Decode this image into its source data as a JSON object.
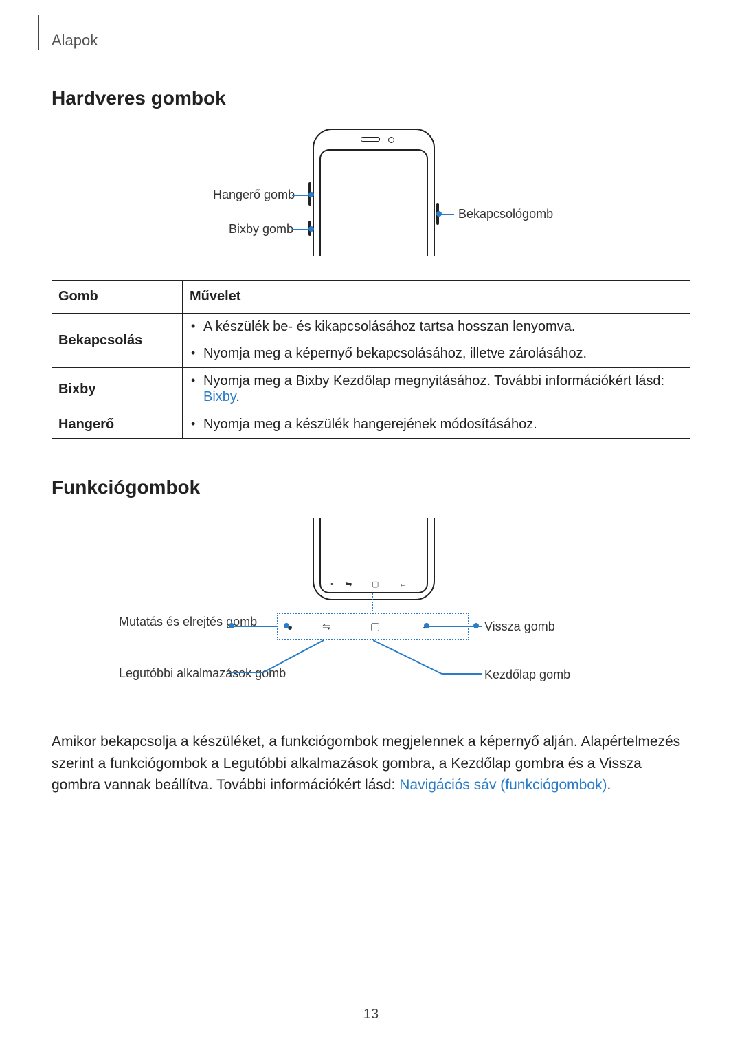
{
  "breadcrumb": "Alapok",
  "section1_title": "Hardveres gombok",
  "diagram1": {
    "volume_label": "Hangerő gomb",
    "bixby_label": "Bixby gomb",
    "power_label": "Bekapcsológomb"
  },
  "table": {
    "header_key": "Gomb",
    "header_action": "Művelet",
    "rows": [
      {
        "key": "Bekapcsolás",
        "actions": [
          "A készülék be- és kikapcsolásához tartsa hosszan lenyomva.",
          "Nyomja meg a képernyő bekapcsolásához, illetve zárolásához."
        ]
      },
      {
        "key": "Bixby",
        "actions_html": {
          "pre": "Nyomja meg a Bixby Kezdőlap megnyitásához. További információkért lásd: ",
          "link": "Bixby",
          "post": "."
        }
      },
      {
        "key": "Hangerő",
        "actions": [
          "Nyomja meg a készülék hangerejének módosításához."
        ]
      }
    ]
  },
  "section2_title": "Funkciógombok",
  "diagram2": {
    "show_hide": "Mutatás és elrejtés gomb",
    "recents": "Legutóbbi alkalmazások gomb",
    "back": "Vissza gomb",
    "home": "Kezdőlap gomb"
  },
  "paragraph": {
    "pre": "Amikor bekapcsolja a készüléket, a funkciógombok megjelennek a képernyő alján. Alapértelmezés szerint a funkciógombok a Legutóbbi alkalmazások gombra, a Kezdőlap gombra és a Vissza gombra vannak beállítva. További információkért lásd: ",
    "link": "Navigációs sáv (funkciógombok)",
    "post": "."
  },
  "page_number": "13"
}
